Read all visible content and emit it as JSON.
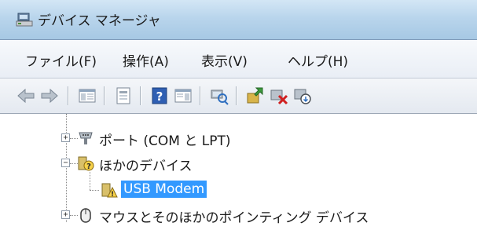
{
  "window": {
    "title": "デバイス マネージャ"
  },
  "menubar": {
    "items": [
      {
        "label": "ファイル(F)"
      },
      {
        "label": "操作(A)"
      },
      {
        "label": "表示(V)"
      },
      {
        "label": "ヘルプ(H)"
      }
    ]
  },
  "toolbar": {
    "icons": [
      "back-arrow-icon",
      "forward-arrow-icon",
      "show-hide-console-tree-icon",
      "properties-icon",
      "help-icon",
      "action-pane-icon",
      "scan-hardware-changes-icon",
      "update-driver-icon",
      "uninstall-icon",
      "disable-device-icon"
    ]
  },
  "tree": {
    "nodes": [
      {
        "label": "ポート (COM と LPT)",
        "expander": "+",
        "icon": "port-connector-icon"
      },
      {
        "label": "ほかのデバイス",
        "expander": "−",
        "icon": "unknown-device-icon"
      },
      {
        "label": "USB Modem",
        "icon": "device-warning-icon",
        "selected": true
      },
      {
        "label": "マウスとそのほかのポインティング デバイス",
        "expander": "+",
        "icon": "mouse-icon"
      }
    ]
  },
  "colors": {
    "selection": "#3399ff",
    "titlebar": "#b9d5ec"
  }
}
